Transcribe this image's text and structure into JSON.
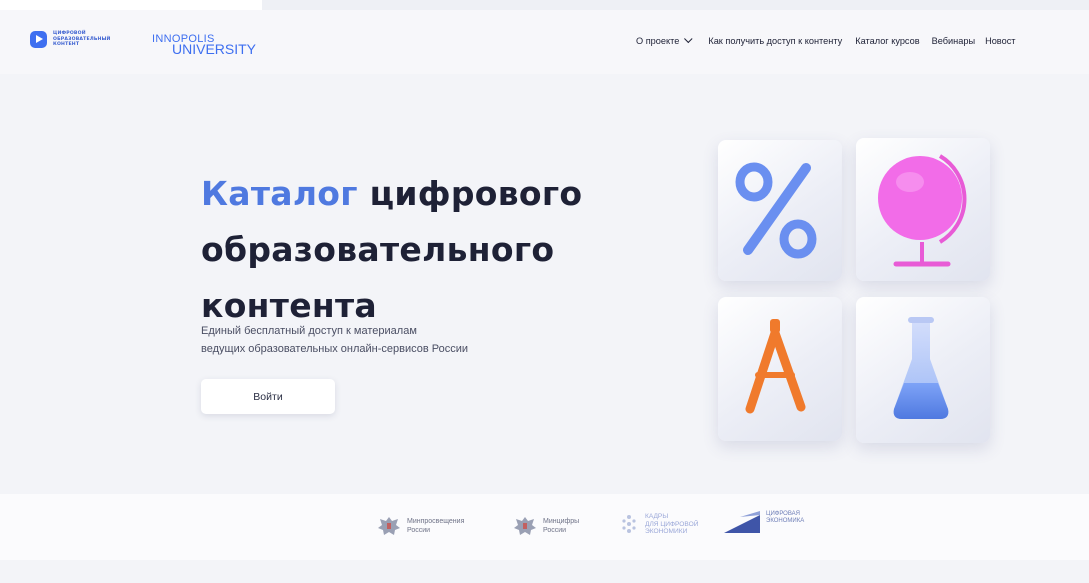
{
  "header": {
    "logo_primary_text": "ЦИФРОВОЙ\nОБРАЗОВАТЕЛЬНЫЙ\nКОНТЕНТ",
    "logo_secondary_line1": "INNOPOLIS",
    "logo_secondary_line2": "UNIVERSITY",
    "nav": [
      {
        "label": "О проекте",
        "has_dropdown": true
      },
      {
        "label": "Как получить доступ к контенту"
      },
      {
        "label": "Каталог курсов"
      },
      {
        "label": "Вебинары"
      },
      {
        "label": "Новост"
      }
    ]
  },
  "hero": {
    "title_accent": "Каталог",
    "title_rest_line1": " цифрового",
    "title_line2": "образовательного",
    "title_line3": "контента",
    "subtitle_line1": "Единый бесплатный доступ к материалам",
    "subtitle_line2": "ведущих образовательных онлайн-сервисов России",
    "cta_label": "Войти"
  },
  "tiles": [
    {
      "icon": "percent-icon",
      "color": "#6a8ff0"
    },
    {
      "icon": "globe-icon",
      "color": "#f26ce8"
    },
    {
      "icon": "compass-drafting-icon",
      "color": "#f07a2c"
    },
    {
      "icon": "flask-icon",
      "color": "#6d94f2"
    }
  ],
  "partners": [
    {
      "icon": "coat-of-arms-icon",
      "text": "Минпросвещения\nРоссии"
    },
    {
      "icon": "coat-of-arms-icon",
      "text": "Минцифры\nРоссии"
    },
    {
      "icon": "kadry-logo-icon",
      "text": "КАДРЫ\nДЛЯ ЦИФРОВОЙ\nЭКОНОМИКИ"
    },
    {
      "icon": "digital-economy-logo-icon",
      "text": "ЦИФРОВАЯ\nЭКОНОМИКА"
    }
  ],
  "colors": {
    "accent": "#4f79e0",
    "brand_blue": "#3e6ff0",
    "text_dark": "#1e2136",
    "background": "#f3f4f8"
  }
}
